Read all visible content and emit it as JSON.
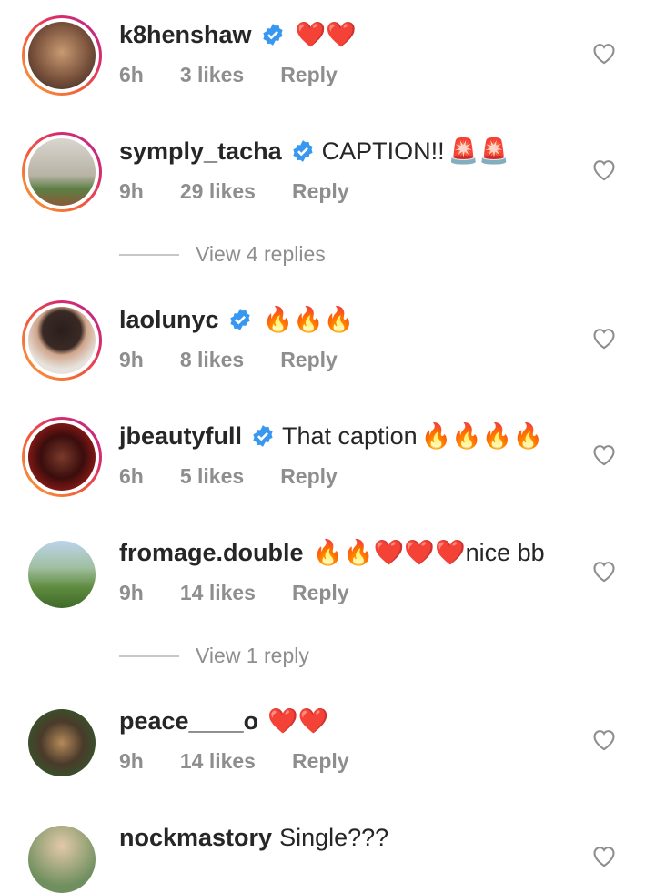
{
  "comments": [
    {
      "username": "k8henshaw",
      "verified": true,
      "text": "",
      "emoji": "❤️❤️",
      "time": "6h",
      "likes": "3 likes",
      "reply": "Reply",
      "story": true,
      "avatar_colors": [
        "#6b4a3a",
        "#caa07a"
      ]
    },
    {
      "username": "symply_tacha",
      "verified": true,
      "text": "CAPTION!!",
      "emoji": "🚨🚨",
      "time": "9h",
      "likes": "29 likes",
      "reply": "Reply",
      "story": true,
      "avatar_colors": [
        "#c9c6bd",
        "#4f7a3f"
      ]
    },
    {
      "username": "laolunyc",
      "verified": true,
      "text": "",
      "emoji": "🔥🔥🔥",
      "time": "9h",
      "likes": "8 likes",
      "reply": "Reply",
      "story": true,
      "avatar_colors": [
        "#e9e4df",
        "#3a2a26"
      ]
    },
    {
      "username": "jbeautyfull",
      "verified": true,
      "text": "That caption",
      "emoji": "🔥🔥🔥🔥",
      "time": "6h",
      "likes": "5 likes",
      "reply": "Reply",
      "story": true,
      "avatar_colors": [
        "#3a0d0d",
        "#b2201a"
      ]
    },
    {
      "username": "fromage.double",
      "verified": false,
      "text": "",
      "emoji": "🔥🔥❤️❤️❤️",
      "text_after": "nice bb",
      "time": "9h",
      "likes": "14 likes",
      "reply": "Reply",
      "story": false,
      "avatar_colors": [
        "#5e8a3e",
        "#a9c7e6"
      ]
    },
    {
      "username": "peace____o",
      "verified": false,
      "text": "",
      "emoji": "❤️❤️",
      "time": "9h",
      "likes": "14 likes",
      "reply": "Reply",
      "story": false,
      "avatar_colors": [
        "#2f5e2c",
        "#b58a5a"
      ]
    },
    {
      "username": "nockmastory",
      "verified": false,
      "text": "Single???",
      "emoji": "",
      "story": false,
      "avatar_colors": [
        "#6f8f5e",
        "#e3c9a8"
      ]
    }
  ],
  "view_replies": [
    {
      "label": "View 4 replies"
    },
    {
      "label": "View 1 reply"
    }
  ],
  "colors": {
    "verified": "#3897f0",
    "meta": "#8e8e8e",
    "text": "#262626"
  }
}
